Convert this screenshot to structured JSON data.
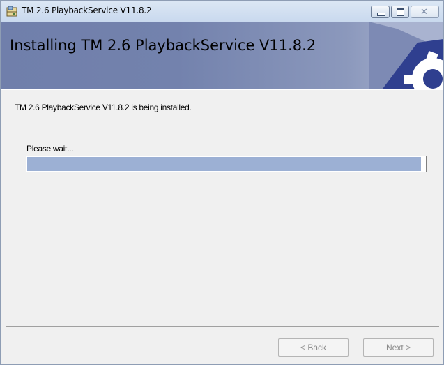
{
  "window": {
    "title": "TM 2.6 PlaybackService V11.8.2",
    "close_glyph": "✕"
  },
  "banner": {
    "title": "Installing TM 2.6 PlaybackService V11.8.2",
    "logo_icon": "gear-icon"
  },
  "main": {
    "status_text": "TM 2.6 PlaybackService V11.8.2 is being installed.",
    "wait_label": "Please wait...",
    "progress": 0.99
  },
  "footer": {
    "back_label": "< Back",
    "next_label": "Next >"
  },
  "colors": {
    "banner": "#7382ad",
    "progress_fill": "#9cb0d4"
  }
}
